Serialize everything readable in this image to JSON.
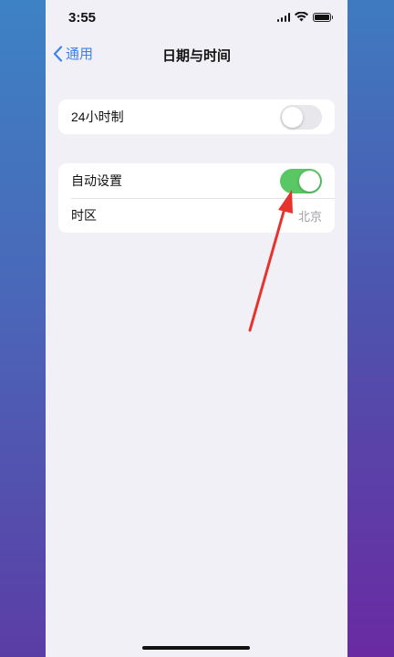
{
  "status_bar": {
    "time": "3:55",
    "icons": [
      "cellular-signal-icon",
      "wifi-icon",
      "battery-icon"
    ]
  },
  "nav": {
    "back_label": "通用",
    "title": "日期与时间"
  },
  "group1": {
    "row1": {
      "label": "24小时制",
      "toggle_on": false
    }
  },
  "group2": {
    "row1": {
      "label": "自动设置",
      "toggle_on": true
    },
    "row2": {
      "label": "时区",
      "value": "北京"
    }
  },
  "colors": {
    "accent": "#3b82f0",
    "toggle_on": "#5ac765",
    "toggle_off": "#e8e8ec",
    "annotation_arrow": "#e8322e",
    "screen_background": "#f1f0f6"
  }
}
